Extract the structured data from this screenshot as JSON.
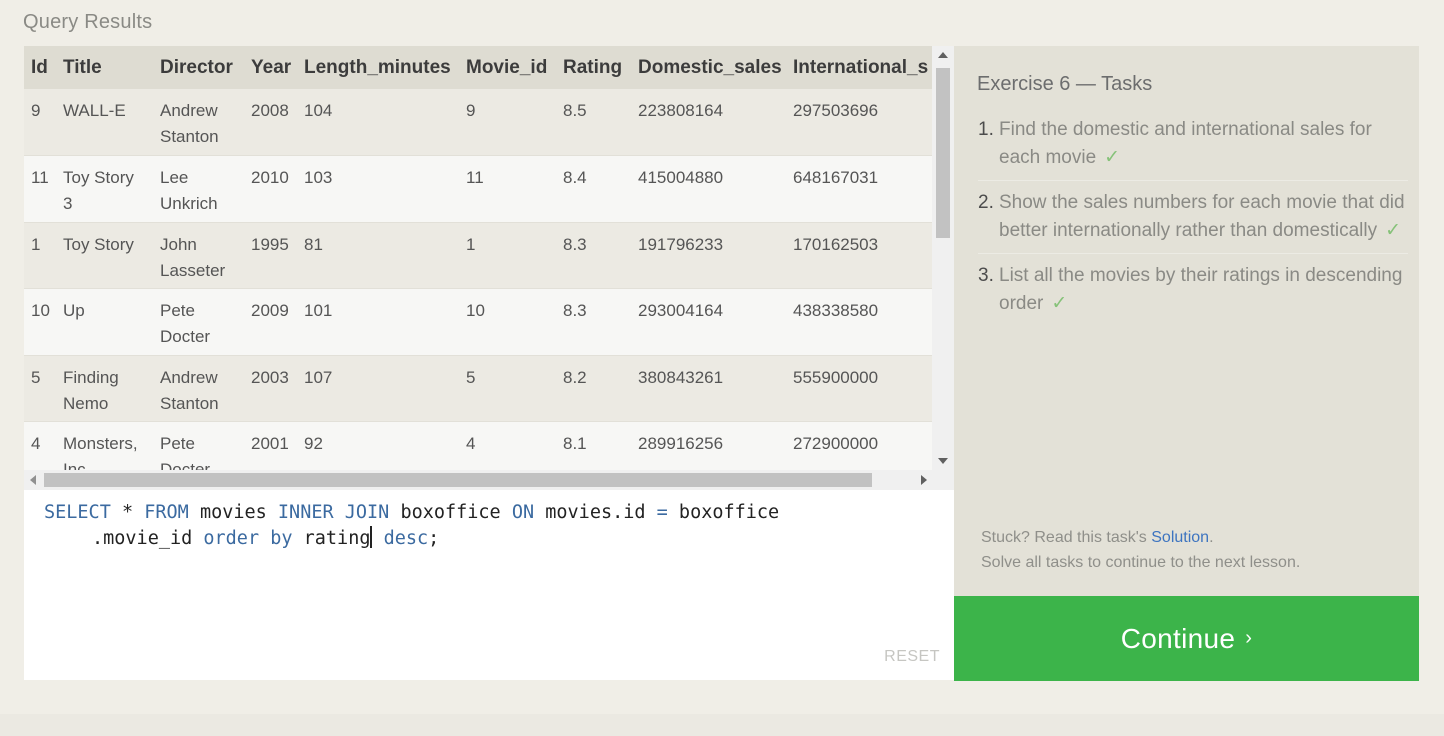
{
  "results": {
    "title": "Query Results",
    "columns": [
      "Id",
      "Title",
      "Director",
      "Year",
      "Length_minutes",
      "Movie_id",
      "Rating",
      "Domestic_sales",
      "International_s"
    ],
    "rows": [
      [
        "9",
        "WALL-E",
        "Andrew Stanton",
        "2008",
        "104",
        "9",
        "8.5",
        "223808164",
        "297503696"
      ],
      [
        "11",
        "Toy Story 3",
        "Lee Unkrich",
        "2010",
        "103",
        "11",
        "8.4",
        "415004880",
        "648167031"
      ],
      [
        "1",
        "Toy Story",
        "John Lasseter",
        "1995",
        "81",
        "1",
        "8.3",
        "191796233",
        "170162503"
      ],
      [
        "10",
        "Up",
        "Pete Docter",
        "2009",
        "101",
        "10",
        "8.3",
        "293004164",
        "438338580"
      ],
      [
        "5",
        "Finding Nemo",
        "Andrew Stanton",
        "2003",
        "107",
        "5",
        "8.2",
        "380843261",
        "555900000"
      ],
      [
        "4",
        "Monsters, Inc.",
        "Pete Docter",
        "2001",
        "92",
        "4",
        "8.1",
        "289916256",
        "272900000"
      ]
    ]
  },
  "editor": {
    "tokens_line1": [
      {
        "t": "SELECT",
        "kw": true
      },
      {
        "t": " * ",
        "kw": false
      },
      {
        "t": "FROM",
        "kw": true
      },
      {
        "t": " movies ",
        "kw": false
      },
      {
        "t": "INNER JOIN",
        "kw": true
      },
      {
        "t": " boxoffice ",
        "kw": false
      },
      {
        "t": "ON",
        "kw": true
      },
      {
        "t": " movies.id ",
        "kw": false
      },
      {
        "t": "=",
        "kw": true
      },
      {
        "t": " boxoffice",
        "kw": false
      }
    ],
    "tokens_line2_before_cursor": [
      {
        "t": ".movie_id ",
        "kw": false
      },
      {
        "t": "order by",
        "kw": true
      },
      {
        "t": " rating",
        "kw": false
      }
    ],
    "tokens_line2_after_cursor": [
      {
        "t": " ",
        "kw": false
      },
      {
        "t": "desc",
        "kw": true
      },
      {
        "t": ";",
        "kw": false
      }
    ],
    "reset_label": "RESET"
  },
  "tasks": {
    "title": "Exercise 6 — Tasks",
    "items": [
      {
        "num": "1.",
        "text": "Find the domestic and international sales for each movie",
        "done": "✓"
      },
      {
        "num": "2.",
        "text": "Show the sales numbers for each movie that did better internationally rather than domestically",
        "done": "✓"
      },
      {
        "num": "3.",
        "text": "List all the movies by their ratings in descending order",
        "done": "✓"
      }
    ],
    "stuck_prefix": "Stuck? Read this task's ",
    "solution_link": "Solution",
    "stuck_suffix": ".",
    "solve_note": "Solve all tasks to continue to the next lesson."
  },
  "continue": {
    "label": "Continue",
    "chevron": "›"
  },
  "colors": {
    "continue_bg": "#3cb44a",
    "keyword": "#3b6aa0",
    "check": "#86c279",
    "link": "#3d74c0"
  }
}
